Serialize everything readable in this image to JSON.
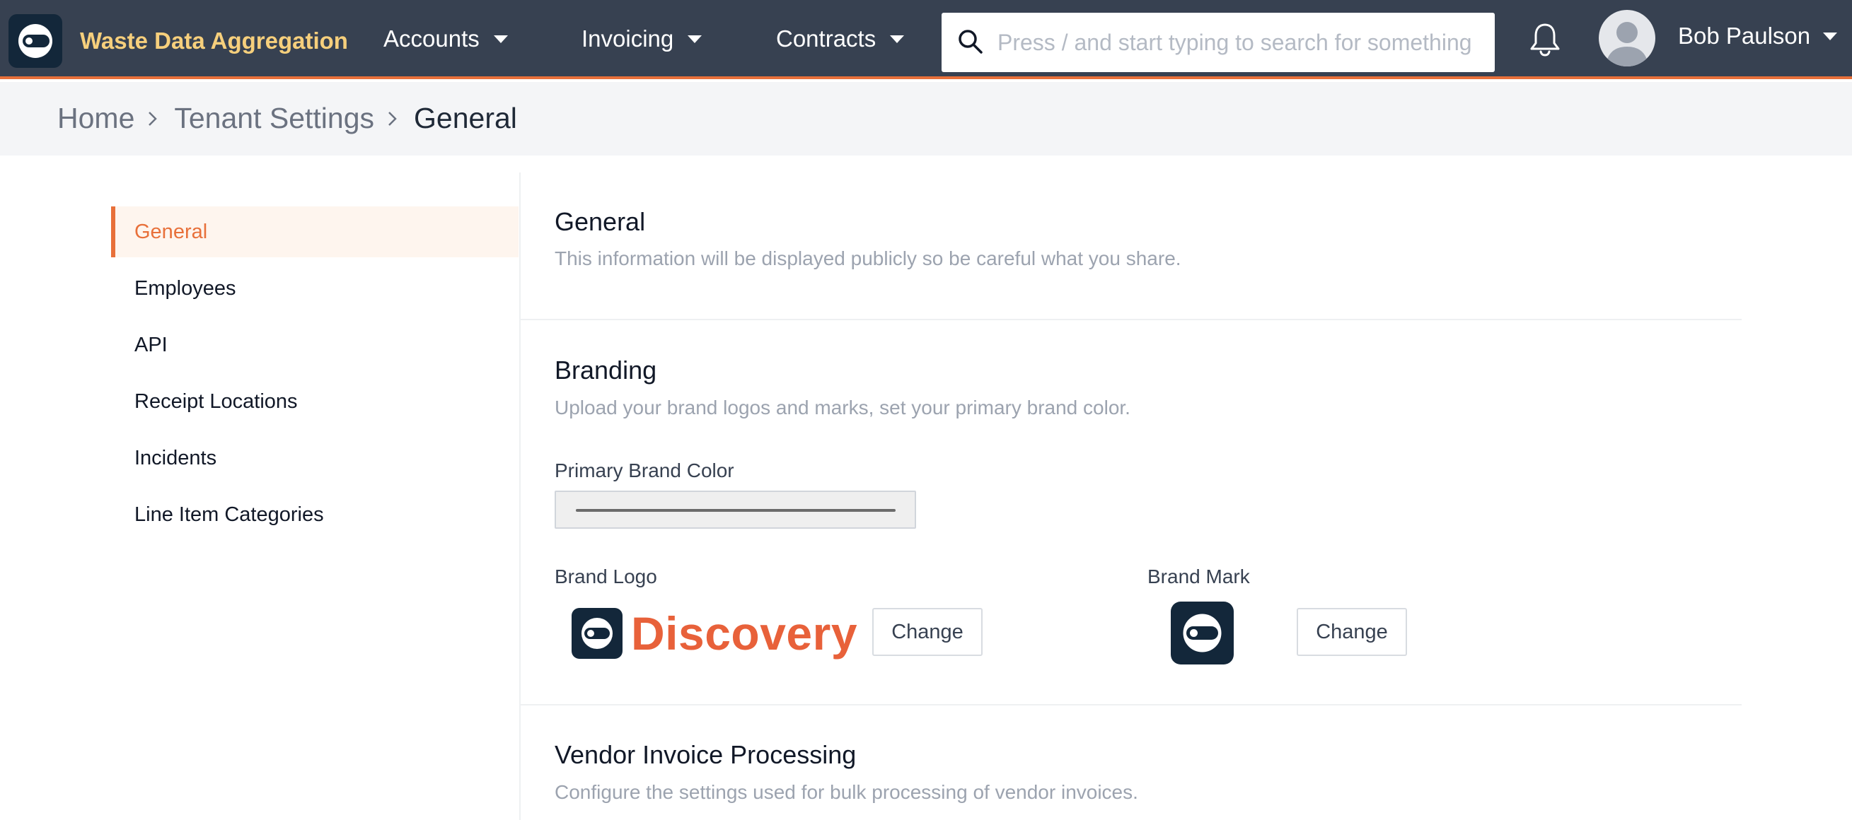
{
  "app": {
    "name": "Waste Data Aggregation"
  },
  "nav": {
    "items": [
      {
        "label": "Accounts"
      },
      {
        "label": "Invoicing"
      },
      {
        "label": "Contracts"
      }
    ],
    "search_placeholder": "Press / and start typing to search for something",
    "user_name": "Bob Paulson"
  },
  "breadcrumb": [
    {
      "label": "Home"
    },
    {
      "label": "Tenant Settings"
    },
    {
      "label": "General"
    }
  ],
  "sidebar": {
    "items": [
      {
        "label": "General",
        "active": true
      },
      {
        "label": "Employees"
      },
      {
        "label": "API"
      },
      {
        "label": "Receipt Locations"
      },
      {
        "label": "Incidents"
      },
      {
        "label": "Line Item Categories"
      }
    ]
  },
  "sections": {
    "general": {
      "title": "General",
      "description": "This information will be displayed publicly so be careful what you share."
    },
    "branding": {
      "title": "Branding",
      "description": "Upload your brand logos and marks, set your primary brand color.",
      "primary_color_label": "Primary Brand Color",
      "logo_label": "Brand Logo",
      "logo_text": "Discovery",
      "mark_label": "Brand Mark",
      "change_label": "Change"
    },
    "vendor_invoice": {
      "title": "Vendor Invoice Processing",
      "description": "Configure the settings used for bulk processing of vendor invoices."
    }
  },
  "colors": {
    "topbar": "#374151",
    "accent": "#e8703a",
    "brand_dark": "#13273a",
    "app_name": "#f6cf7c"
  },
  "icons": [
    "app-logo-icon",
    "chevron-down-icon",
    "search-icon",
    "bell-icon",
    "chevron-right-icon",
    "brand-mark-icon"
  ]
}
